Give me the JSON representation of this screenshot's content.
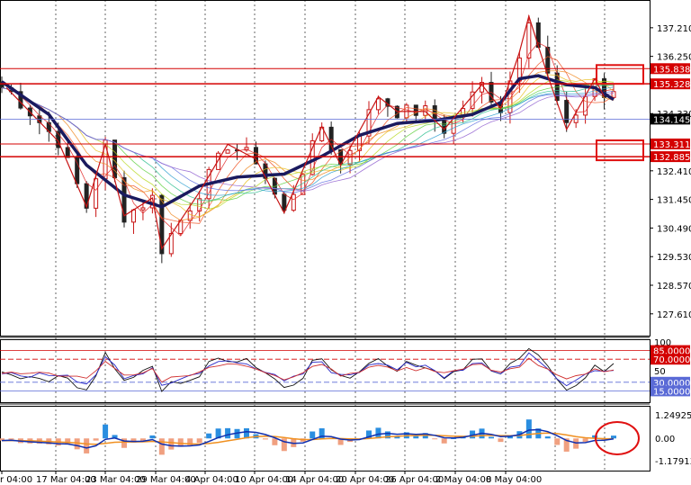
{
  "colors": {
    "background": "#ffffff",
    "grid": "#000000",
    "level_line": "#d40000",
    "bull_candle": "#c81414",
    "bear_candle": "#222222",
    "slow_ma": "#1a1a5e",
    "current_line": "#5a6ad6",
    "osc_fast": "#111111",
    "osc_mid": "#2a2ac8",
    "osc_slow": "#d03030",
    "hist_pos": "#2a8ee0",
    "hist_neg": "#f0a080",
    "macd_line": "#1030b0",
    "signal_line": "#f09020",
    "annotation": "#e01010"
  },
  "chart_data": [
    {
      "type": "candlestick",
      "panel": "price",
      "x_labels": [
        "r 04:00",
        "17 Mar 04:00",
        "23 Mar 04:00",
        "29 Mar 04:00",
        "4 Apr 04:00",
        "10 Apr 04:00",
        "14 Apr 04:00",
        "20 Apr 04:00",
        "26 Apr 04:00",
        "2 May 04:00",
        "8 May 04:00"
      ],
      "y_ticks": [
        "137.210",
        "136.250",
        "134.330",
        "132.410",
        "131.450",
        "130.490",
        "129.530",
        "128.570",
        "127.610"
      ],
      "ylim": [
        127.0,
        137.9
      ],
      "current_price": "134.145",
      "levels": [
        "135.838",
        "135.328",
        "133.311",
        "132.885"
      ],
      "swing_path": [
        [
          0.5,
          135.2
        ],
        [
          6,
          133.4
        ],
        [
          9,
          131.2
        ],
        [
          11,
          133.3
        ],
        [
          13,
          130.9
        ],
        [
          16,
          131.5
        ],
        [
          17,
          129.8
        ],
        [
          21,
          131.7
        ],
        [
          24,
          133.3
        ],
        [
          27,
          132.8
        ],
        [
          30,
          131.0
        ],
        [
          34,
          133.9
        ],
        [
          36,
          132.6
        ],
        [
          40,
          134.9
        ],
        [
          42,
          134.4
        ],
        [
          45,
          134.4
        ],
        [
          47,
          133.8
        ],
        [
          51,
          135.3
        ],
        [
          53,
          134.5
        ],
        [
          55,
          136.4
        ],
        [
          56,
          137.6
        ],
        [
          58,
          135.6
        ],
        [
          60,
          133.8
        ],
        [
          63,
          135.5
        ],
        [
          64,
          134.9
        ]
      ],
      "slow_ma_path": [
        [
          0,
          135.4
        ],
        [
          5,
          134.3
        ],
        [
          9,
          132.6
        ],
        [
          13,
          131.6
        ],
        [
          17,
          131.2
        ],
        [
          21,
          131.9
        ],
        [
          25,
          132.2
        ],
        [
          30,
          132.3
        ],
        [
          34,
          132.9
        ],
        [
          38,
          133.6
        ],
        [
          42,
          134.0
        ],
        [
          46,
          134.1
        ],
        [
          50,
          134.3
        ],
        [
          53,
          134.7
        ],
        [
          55,
          135.5
        ],
        [
          57,
          135.6
        ],
        [
          60,
          135.3
        ],
        [
          63,
          135.2
        ],
        [
          65,
          134.8
        ]
      ]
    },
    {
      "type": "line",
      "panel": "oscillator",
      "y_ticks": [
        "100",
        "85.0000",
        "70.0000",
        "50",
        "30.0000",
        "15.0000"
      ],
      "ylim": [
        0,
        100
      ],
      "levels": [
        85,
        70,
        30,
        15
      ]
    },
    {
      "type": "bar",
      "panel": "macd",
      "y_ticks": [
        "1.24925",
        "0.00",
        "-1.17913"
      ],
      "ylim": [
        -1.17913,
        1.24925
      ]
    }
  ]
}
